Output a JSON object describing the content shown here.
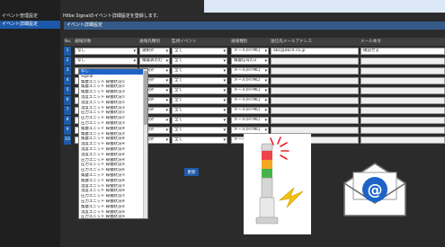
{
  "sidebar": {
    "items": [
      {
        "label": "イベント管理設定"
      },
      {
        "label": "イベント詳細設定"
      }
    ]
  },
  "header": {
    "message": "Hilbe Signalのイベント詳細設定を登録します。"
  },
  "section": {
    "title": "イベント詳細設定"
  },
  "table": {
    "columns": [
      "No.",
      "通報対象",
      "通報先種別",
      "監視イベント",
      "通報種別",
      "送信先メールアドレス",
      "メール本文"
    ],
    "rows": [
      {
        "no": "1",
        "target": "なし",
        "dest_type": "選択外",
        "event": "全て",
        "kind": "メール(HTML)",
        "email": "abc@abcd.co.jp",
        "body": "確認せよ"
      },
      {
        "no": "2",
        "target": "なし",
        "dest_type": "積層表示灯",
        "event": "全て",
        "kind": "積層信号灯2",
        "email": "",
        "body": ""
      },
      {
        "no": "3",
        "target": "",
        "dest_type": "選択外",
        "event": "全て",
        "kind": "メール(HTML)",
        "email": "",
        "body": ""
      },
      {
        "no": "4",
        "target": "",
        "dest_type": "選択外",
        "event": "全て",
        "kind": "メール(HTML)",
        "email": "",
        "body": ""
      },
      {
        "no": "5",
        "target": "",
        "dest_type": "選択外",
        "event": "全て",
        "kind": "メール(HTML)",
        "email": "",
        "body": ""
      },
      {
        "no": "6",
        "target": "",
        "dest_type": "選択外",
        "event": "全て",
        "kind": "メール(HTML)",
        "email": "",
        "body": ""
      },
      {
        "no": "7",
        "target": "",
        "dest_type": "選択外",
        "event": "全て",
        "kind": "メール(HTML)",
        "email": "",
        "body": ""
      },
      {
        "no": "8",
        "target": "",
        "dest_type": "選択外",
        "event": "全て",
        "kind": "メール(HTML)",
        "email": "",
        "body": ""
      },
      {
        "no": "9",
        "target": "",
        "dest_type": "選択外",
        "event": "全て",
        "kind": "メール(HTML)",
        "email": "",
        "body": ""
      },
      {
        "no": "10",
        "target": "",
        "dest_type": "選択外",
        "event": "全て",
        "kind": "メール(HTML)",
        "email": "",
        "body": ""
      }
    ]
  },
  "dropdown": {
    "options": [
      "なし",
      "Signal",
      "集塵ユニット 稼働状況①",
      "集塵ユニット 稼働状況②",
      "集塵ユニット 稼働状況③",
      "温度ユニット 稼働状況①",
      "温度ユニット 稼働状況②",
      "温度ユニット 稼働状況③",
      "圧力ユニット 稼働状況①",
      "圧力ユニット 稼働状況②",
      "圧力ユニット 稼働状況③",
      "集塵ユニット 稼働状況④",
      "集塵ユニット 稼働状況⑤",
      "集塵ユニット 稼働状況⑥",
      "温度ユニット 稼働状況④",
      "温度ユニット 稼働状況⑤",
      "温度ユニット 稼働状況⑥",
      "圧力ユニット 稼働状況④",
      "圧力ユニット 稼働状況⑤",
      "圧力ユニット 稼働状況⑥",
      "集塵ユニット 稼働状況⑦",
      "集塵ユニット 稼働状況⑧",
      "温度ユニット 稼働状況⑦",
      "温度ユニット 稼働状況⑧",
      "圧力ユニット 稼働状況⑦",
      "圧力ユニット 稼働状況⑧",
      "集塵ユニット 稼働状況⑨",
      "温度ユニット 稼働状況⑨",
      "圧力ユニット 稼働状況⑨"
    ],
    "highlighted_index": 0
  },
  "update_button": {
    "label": "更新"
  },
  "illustrations": {
    "signal_tower_icon": "signal-tower-icon",
    "mail_icon": "envelope-at-icon"
  },
  "colors": {
    "accent_blue": "#1e5aa8",
    "section_blue": "#355a88",
    "mail_blue": "#1e64c8"
  }
}
